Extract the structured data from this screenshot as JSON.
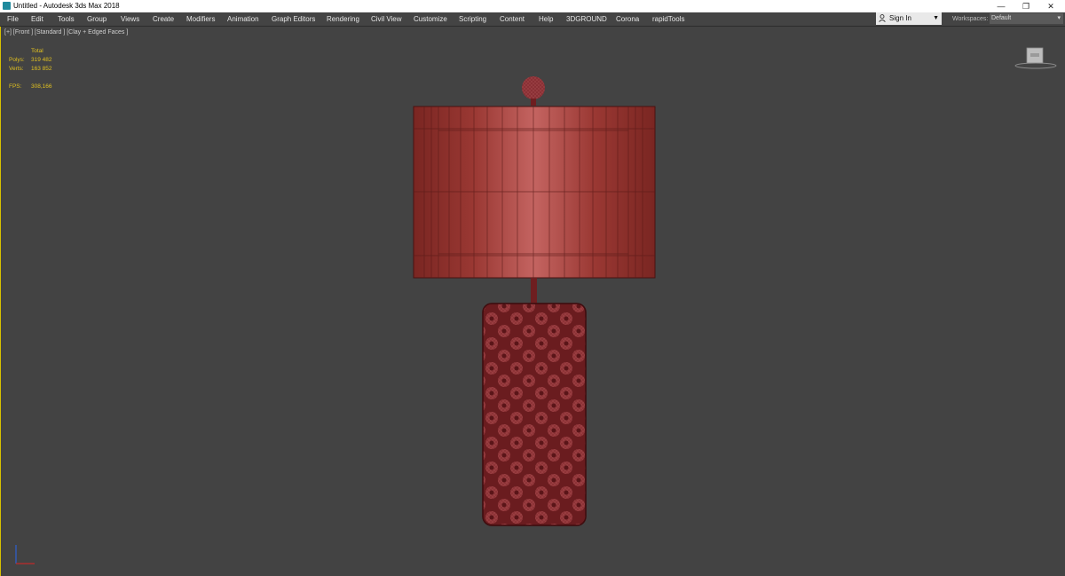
{
  "window": {
    "title": "Untitled - Autodesk 3ds Max 2018",
    "controls": {
      "minimize": "—",
      "restore": "❐",
      "close": "✕"
    }
  },
  "menu": {
    "items": [
      "File",
      "Edit",
      "Tools",
      "Group",
      "Views",
      "Create",
      "Modifiers",
      "Animation",
      "Graph Editors",
      "Rendering",
      "Civil View",
      "Customize",
      "Scripting",
      "Content",
      "Help",
      "3DGROUND",
      "Corona",
      "rapidTools"
    ],
    "sign_in": "Sign In",
    "workspaces_label": "Workspaces:",
    "workspace_value": "Default"
  },
  "viewport": {
    "label": "[+] [Front ] [Standard ] [Clay + Edged Faces ]",
    "stats": {
      "header": "Total",
      "polys_label": "Polys:",
      "polys_value": "319 482",
      "verts_label": "Verts:",
      "verts_value": "163 852",
      "fps_label": "FPS:",
      "fps_value": "308,166"
    }
  },
  "colors": {
    "accent_stats": "#e0c020",
    "lamp_shade": "#a8423c",
    "lamp_base": "#6e1e20",
    "viewport_bg": "#434343"
  },
  "icons": {
    "app": "3ds-max-app-icon",
    "user": "user-icon",
    "viewcube": "viewcube-icon",
    "axis": "axis-tripod-icon"
  }
}
